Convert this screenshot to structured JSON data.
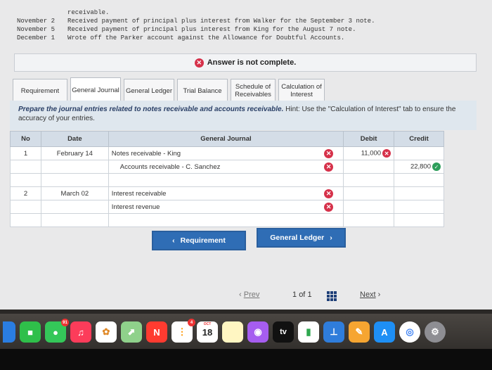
{
  "problem": {
    "line0": "receivable.",
    "lines": [
      {
        "date": "November 2",
        "text": "Received payment of principal plus interest from Walker for the September 3 note."
      },
      {
        "date": "November 5",
        "text": "Received payment of principal plus interest from King for the August 7 note."
      },
      {
        "date": "December 1",
        "text": "Wrote off the Parker account against the Allowance for Doubtful Accounts."
      }
    ]
  },
  "status": {
    "text": "Answer is not complete."
  },
  "tabs": [
    "Requirement",
    "General Journal",
    "General Ledger",
    "Trial Balance",
    "Schedule of Receivables",
    "Calculation of Interest"
  ],
  "instruction": {
    "lead": "Prepare the journal entries related to notes receivable and accounts receivable.",
    "hint": " Hint:  Use the \"Calculation of Interest\" tab to ensure the accuracy of your entries."
  },
  "journal": {
    "headers": {
      "no": "No",
      "date": "Date",
      "account": "General Journal",
      "debit": "Debit",
      "credit": "Credit"
    },
    "rows": [
      {
        "no": "1",
        "date": "February 14",
        "account": "Notes receivable - King",
        "debit": "11,000",
        "credit": ""
      },
      {
        "no": "",
        "date": "",
        "account": "Accounts receivable - C. Sanchez",
        "debit": "",
        "credit": "22,800"
      },
      {
        "no": "",
        "date": "",
        "account": "",
        "debit": "",
        "credit": ""
      },
      {
        "no": "2",
        "date": "March 02",
        "account": "Interest receivable",
        "debit": "",
        "credit": ""
      },
      {
        "no": "",
        "date": "",
        "account": "Interest revenue",
        "debit": "",
        "credit": ""
      },
      {
        "no": "",
        "date": "",
        "account": "",
        "debit": "",
        "credit": ""
      }
    ]
  },
  "nav": {
    "prev_label": "Requirement",
    "next_label": "General Ledger"
  },
  "pager": {
    "prev": "Prev",
    "page": "1",
    "of": "of",
    "total": "1",
    "next": "Next"
  },
  "dock": {
    "calendar_month": "OCT",
    "calendar_day": "18",
    "messages_badge": "91",
    "calendar_badge": "4",
    "tv_label": "tv",
    "icons": [
      "finder-icon",
      "facetime-icon",
      "messages-icon",
      "music-icon",
      "photos-icon",
      "maps-icon",
      "news-icon",
      "reminders-icon",
      "calendar-icon",
      "notes-icon",
      "podcasts-icon",
      "apple-tv-icon",
      "numbers-icon",
      "keynote-icon",
      "pages-icon",
      "app-store-icon",
      "chrome-icon",
      "settings-icon"
    ]
  },
  "colors": {
    "accent": "#2f6db5",
    "error": "#d6314a",
    "success": "#2e9e5b",
    "header_bg": "#d4dde7"
  }
}
